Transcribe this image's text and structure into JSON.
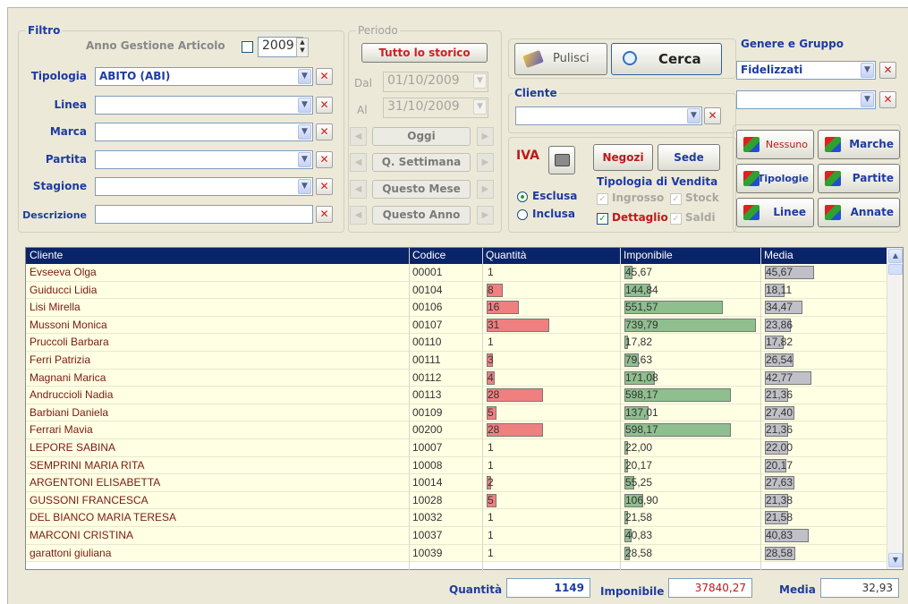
{
  "filtro": {
    "legend": "Filtro",
    "anno_label": "Anno Gestione Articolo",
    "anno_value": "2009",
    "tipologia_label": "Tipologia",
    "tipologia_value": "ABITO  (ABI)",
    "linea_label": "Linea",
    "marca_label": "Marca",
    "partita_label": "Partita",
    "stagione_label": "Stagione",
    "descrizione_label": "Descrizione"
  },
  "periodo": {
    "legend": "Periodo",
    "tutto_lo_storico": "Tutto lo storico",
    "dal_label": "Dal",
    "dal_value": "01/10/2009",
    "al_label": "Al",
    "al_value": "31/10/2009",
    "oggi": "Oggi",
    "settimana": "Q. Settimana",
    "mese": "Questo Mese",
    "anno": "Questo Anno"
  },
  "actions": {
    "pulisci": "Pulisci",
    "cerca": "Cerca"
  },
  "cliente": {
    "legend": "Cliente"
  },
  "iva": {
    "label": "IVA",
    "esclusa": "Esclusa",
    "inclusa": "Inclusa",
    "negozi": "Negozi",
    "sede": "Sede"
  },
  "tipologia_vendita": {
    "title": "Tipologia di Vendita",
    "ingrosso": "Ingrosso",
    "stock": "Stock",
    "dettaglio": "Dettaglio",
    "saldi": "Saldi"
  },
  "genere": {
    "legend": "Genere e Gruppo",
    "value": "Fidelizzati"
  },
  "group_buttons": {
    "nessuno": "Nessuno",
    "marche": "Marche",
    "tipologie": "Tipologie",
    "partite": "Partite",
    "linee": "Linee",
    "annate": "Annate"
  },
  "table": {
    "headers": [
      "Cliente",
      "Codice",
      "Quantità",
      "Imponibile",
      "Media"
    ],
    "rows": [
      {
        "cliente": "Evseeva Olga",
        "codice": "00001",
        "quantita": "1",
        "imponibile": "45,67",
        "media": "45,67"
      },
      {
        "cliente": "Guiducci Lidia",
        "codice": "00104",
        "quantita": "8",
        "imponibile": "144,84",
        "media": "18,11"
      },
      {
        "cliente": "Lisi Mirella",
        "codice": "00106",
        "quantita": "16",
        "imponibile": "551,57",
        "media": "34,47"
      },
      {
        "cliente": "Mussoni Monica",
        "codice": "00107",
        "quantita": "31",
        "imponibile": "739,79",
        "media": "23,86"
      },
      {
        "cliente": "Pruccoli Barbara",
        "codice": "00110",
        "quantita": "1",
        "imponibile": "17,82",
        "media": "17,82"
      },
      {
        "cliente": "Ferri Patrizia",
        "codice": "00111",
        "quantita": "3",
        "imponibile": "79,63",
        "media": "26,54"
      },
      {
        "cliente": "Magnani Marica",
        "codice": "00112",
        "quantita": "4",
        "imponibile": "171,08",
        "media": "42,77"
      },
      {
        "cliente": "Andruccioli Nadia",
        "codice": "00113",
        "quantita": "28",
        "imponibile": "598,17",
        "media": "21,36"
      },
      {
        "cliente": "Barbiani Daniela",
        "codice": "00109",
        "quantita": "5",
        "imponibile": "137,01",
        "media": "27,40"
      },
      {
        "cliente": "Ferrari Mavia",
        "codice": "00200",
        "quantita": "28",
        "imponibile": "598,17",
        "media": "21,36"
      },
      {
        "cliente": "LEPORE SABINA",
        "codice": "10007",
        "quantita": "1",
        "imponibile": "22,00",
        "media": "22,00"
      },
      {
        "cliente": "SEMPRINI MARIA RITA",
        "codice": "10008",
        "quantita": "1",
        "imponibile": "20,17",
        "media": "20,17"
      },
      {
        "cliente": "ARGENTONI ELISABETTA",
        "codice": "10014",
        "quantita": "2",
        "imponibile": "55,25",
        "media": "27,63"
      },
      {
        "cliente": "GUSSONI FRANCESCA",
        "codice": "10028",
        "quantita": "5",
        "imponibile": "106,90",
        "media": "21,38"
      },
      {
        "cliente": "DEL BIANCO MARIA TERESA",
        "codice": "10032",
        "quantita": "1",
        "imponibile": "21,58",
        "media": "21,58"
      },
      {
        "cliente": "MARCONI CRISTINA",
        "codice": "10037",
        "quantita": "1",
        "imponibile": "40,83",
        "media": "40,83"
      },
      {
        "cliente": "garattoni giuliana",
        "codice": "10039",
        "quantita": "1",
        "imponibile": "28,58",
        "media": "28,58"
      }
    ]
  },
  "totals": {
    "quantita_label": "Quantità",
    "quantita_value": "1149",
    "imponibile_label": "Imponibile",
    "imponibile_value": "37840,27",
    "media_label": "Media",
    "media_value": "32,93"
  },
  "colors": {
    "label_blue": "#1e3ca0",
    "red_text": "#d02020",
    "header_navy": "#0a246a",
    "row_bg": "#ffffe4",
    "qty_bar": "#f08080",
    "imp_bar": "#8fbf8f",
    "media_bar": "#c0c0c8"
  }
}
